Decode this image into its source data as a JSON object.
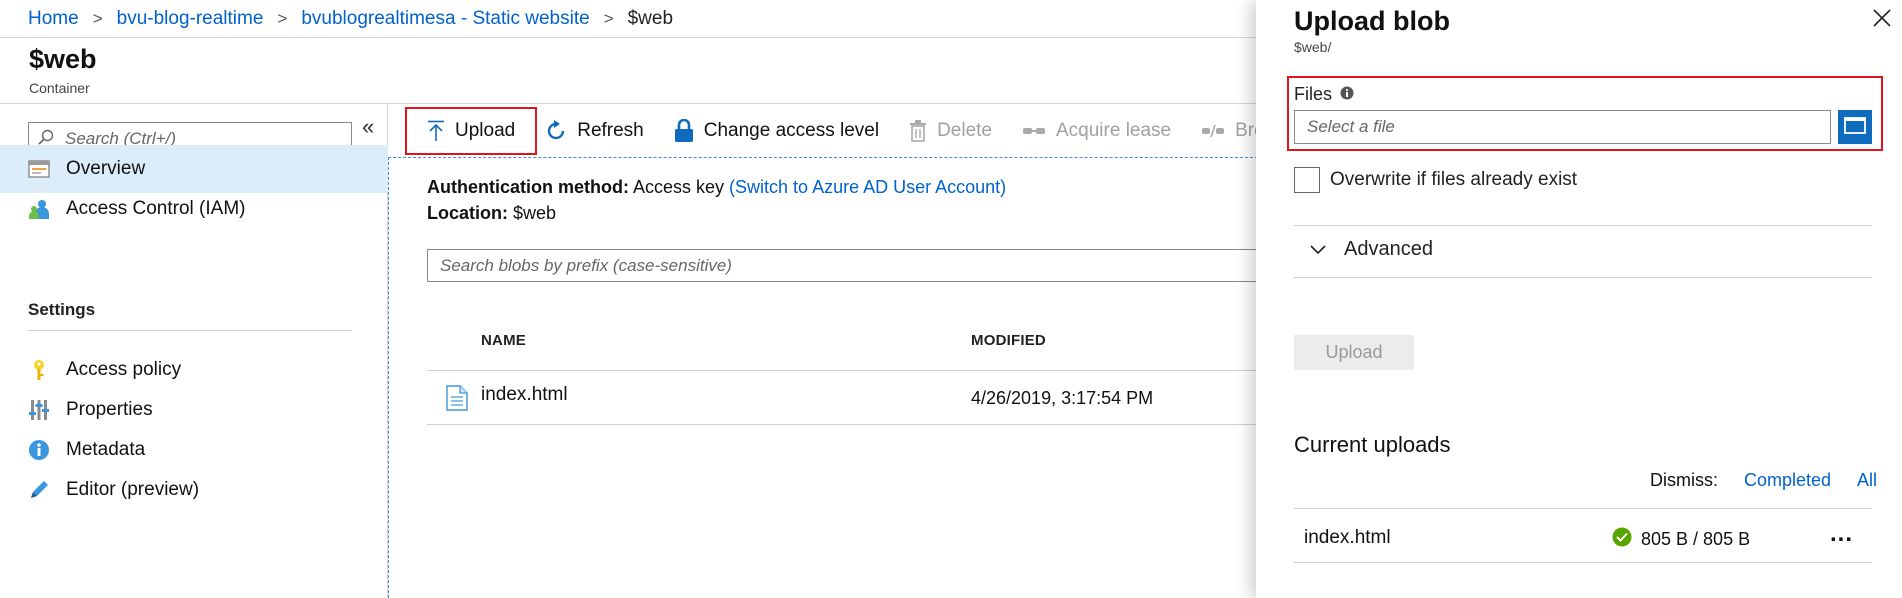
{
  "breadcrumb": {
    "items": [
      "Home",
      "bvu-blog-realtime",
      "bvublogrealtimesa - Static website"
    ],
    "current": "$web"
  },
  "page": {
    "title": "$web",
    "subtitle": "Container"
  },
  "sidebar": {
    "search_placeholder": "Search (Ctrl+/)",
    "items": [
      {
        "label": "Overview",
        "icon": "overview-icon"
      },
      {
        "label": "Access Control (IAM)",
        "icon": "iam-icon"
      }
    ],
    "settings_title": "Settings",
    "settings_items": [
      {
        "label": "Access policy",
        "icon": "key-icon"
      },
      {
        "label": "Properties",
        "icon": "properties-icon"
      },
      {
        "label": "Metadata",
        "icon": "info-icon"
      },
      {
        "label": "Editor (preview)",
        "icon": "pencil-icon"
      }
    ]
  },
  "toolbar": {
    "upload": "Upload",
    "refresh": "Refresh",
    "change_access": "Change access level",
    "delete": "Delete",
    "acquire_lease": "Acquire lease",
    "break_lease": "Bre"
  },
  "main": {
    "auth_label": "Authentication method:",
    "auth_value": "Access key",
    "auth_link": "(Switch to Azure AD User Account)",
    "location_label": "Location:",
    "location_value": "$web",
    "search_placeholder": "Search blobs by prefix (case-sensitive)",
    "columns": [
      "NAME",
      "MODIFIED"
    ],
    "rows": [
      {
        "name": "index.html",
        "modified": "4/26/2019, 3:17:54 PM"
      }
    ]
  },
  "panel": {
    "title": "Upload blob",
    "subtitle": "$web/",
    "files_label": "Files",
    "file_placeholder": "Select a file",
    "overwrite_label": "Overwrite if files already exist",
    "advanced_label": "Advanced",
    "upload_button": "Upload",
    "current_uploads_title": "Current uploads",
    "dismiss_label": "Dismiss:",
    "dismiss_completed": "Completed",
    "dismiss_all": "All",
    "uploads": [
      {
        "name": "index.html",
        "status": "805 B / 805 B",
        "more": "..."
      }
    ]
  },
  "colors": {
    "accent": "#0062cc",
    "highlight": "#e2141b",
    "active_nav": "#dcecf8",
    "success": "#57a300"
  }
}
